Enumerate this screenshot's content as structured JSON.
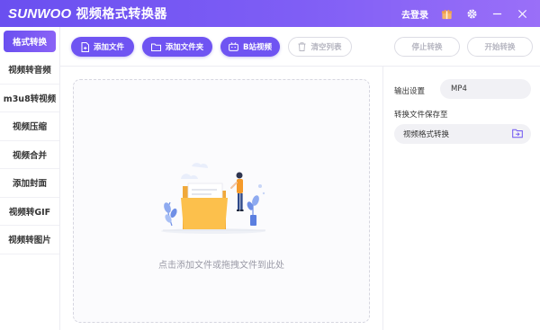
{
  "titlebar": {
    "logo": "SUNWOO",
    "title": "视频格式转换器",
    "login": "去登录",
    "icons": [
      "gift-icon",
      "gear-icon",
      "minimize-icon",
      "close-icon"
    ]
  },
  "sidebar": {
    "items": [
      {
        "label": "格式转换",
        "active": true
      },
      {
        "label": "视频转音频"
      },
      {
        "label": "m3u8转视频"
      },
      {
        "label": "视频压缩"
      },
      {
        "label": "视频合并"
      },
      {
        "label": "添加封面"
      },
      {
        "label": "视频转GIF"
      },
      {
        "label": "视频转图片"
      }
    ]
  },
  "toolbar": {
    "add_file": "添加文件",
    "add_folder": "添加文件夹",
    "bilibili": "B站视频",
    "clear_list": "清空列表",
    "stop": "停止转换",
    "start": "开始转换"
  },
  "dropzone": {
    "hint": "点击添加文件或拖拽文件到此处"
  },
  "settings": {
    "output_label": "输出设置",
    "output_format": "MP4",
    "save_label": "转换文件保存至",
    "save_path": "视频格式转换"
  },
  "colors": {
    "accent": "#6f54f2",
    "titlebar_start": "#6a4ff0",
    "titlebar_end": "#9a6ff8"
  }
}
